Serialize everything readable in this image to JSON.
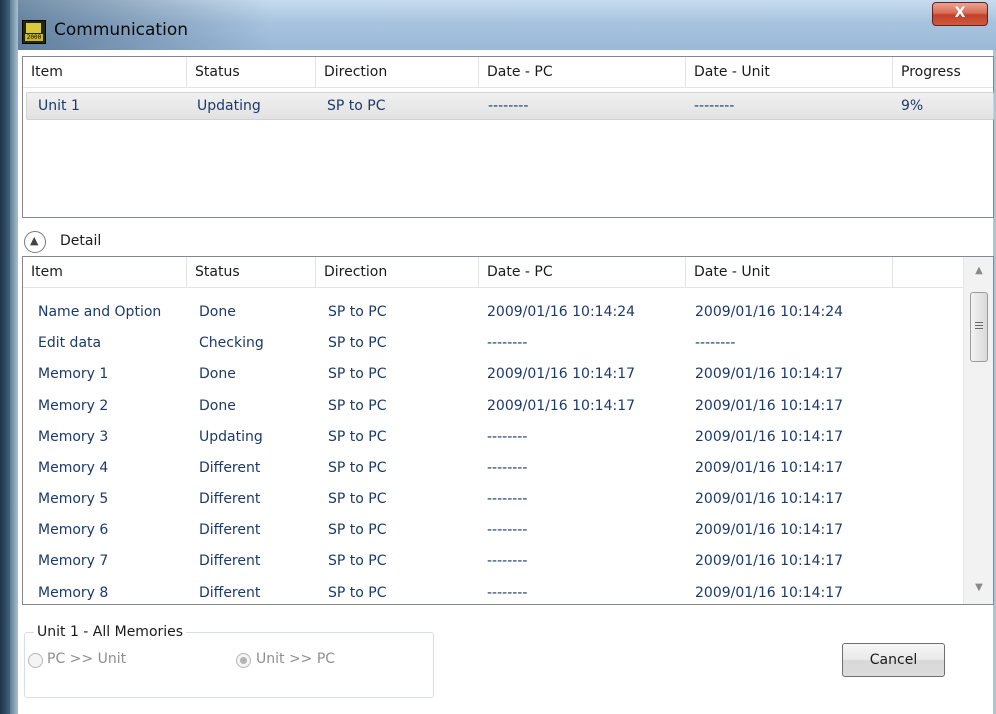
{
  "window": {
    "title": "Communication",
    "close_label": "X",
    "icon_top_text": "",
    "icon_bottom_text": "2000"
  },
  "top_list": {
    "columns": [
      "Item",
      "Status",
      "Direction",
      "Date - PC",
      "Date - Unit",
      "Progress"
    ],
    "rows": [
      {
        "item": "Unit 1",
        "status": "Updating",
        "direction": "SP to PC",
        "date_pc": "--------",
        "date_unit": "--------",
        "progress": "9%"
      }
    ]
  },
  "detail": {
    "toggle_label": "Detail",
    "columns": [
      "Item",
      "Status",
      "Direction",
      "Date - PC",
      "Date - Unit"
    ],
    "rows": [
      {
        "item": "Name and Option",
        "status": "Done",
        "direction": "SP to PC",
        "date_pc": "2009/01/16 10:14:24",
        "date_unit": "2009/01/16 10:14:24"
      },
      {
        "item": "Edit data",
        "status": "Checking",
        "direction": "SP to PC",
        "date_pc": "--------",
        "date_unit": "--------"
      },
      {
        "item": "Memory 1",
        "status": "Done",
        "direction": "SP to PC",
        "date_pc": "2009/01/16 10:14:17",
        "date_unit": "2009/01/16 10:14:17"
      },
      {
        "item": "Memory 2",
        "status": "Done",
        "direction": "SP to PC",
        "date_pc": "2009/01/16 10:14:17",
        "date_unit": "2009/01/16 10:14:17"
      },
      {
        "item": "Memory 3",
        "status": "Updating",
        "direction": "SP to PC",
        "date_pc": "--------",
        "date_unit": "2009/01/16 10:14:17"
      },
      {
        "item": "Memory 4",
        "status": "Different",
        "direction": "SP to PC",
        "date_pc": "--------",
        "date_unit": "2009/01/16 10:14:17"
      },
      {
        "item": "Memory 5",
        "status": "Different",
        "direction": "SP to PC",
        "date_pc": "--------",
        "date_unit": "2009/01/16 10:14:17"
      },
      {
        "item": "Memory 6",
        "status": "Different",
        "direction": "SP to PC",
        "date_pc": "--------",
        "date_unit": "2009/01/16 10:14:17"
      },
      {
        "item": "Memory 7",
        "status": "Different",
        "direction": "SP to PC",
        "date_pc": "--------",
        "date_unit": "2009/01/16 10:14:17"
      },
      {
        "item": "Memory 8",
        "status": "Different",
        "direction": "SP to PC",
        "date_pc": "--------",
        "date_unit": "2009/01/16 10:14:17"
      }
    ]
  },
  "group": {
    "legend": "Unit 1 - All Memories",
    "options": [
      {
        "label": "PC >> Unit",
        "selected": false
      },
      {
        "label": "Unit >> PC",
        "selected": true
      }
    ]
  },
  "buttons": {
    "cancel_label": "Cancel"
  },
  "colors": {
    "row_text": "#1b3a6b",
    "title_bar": "#a7c3de",
    "close_red": "#c1402a"
  }
}
